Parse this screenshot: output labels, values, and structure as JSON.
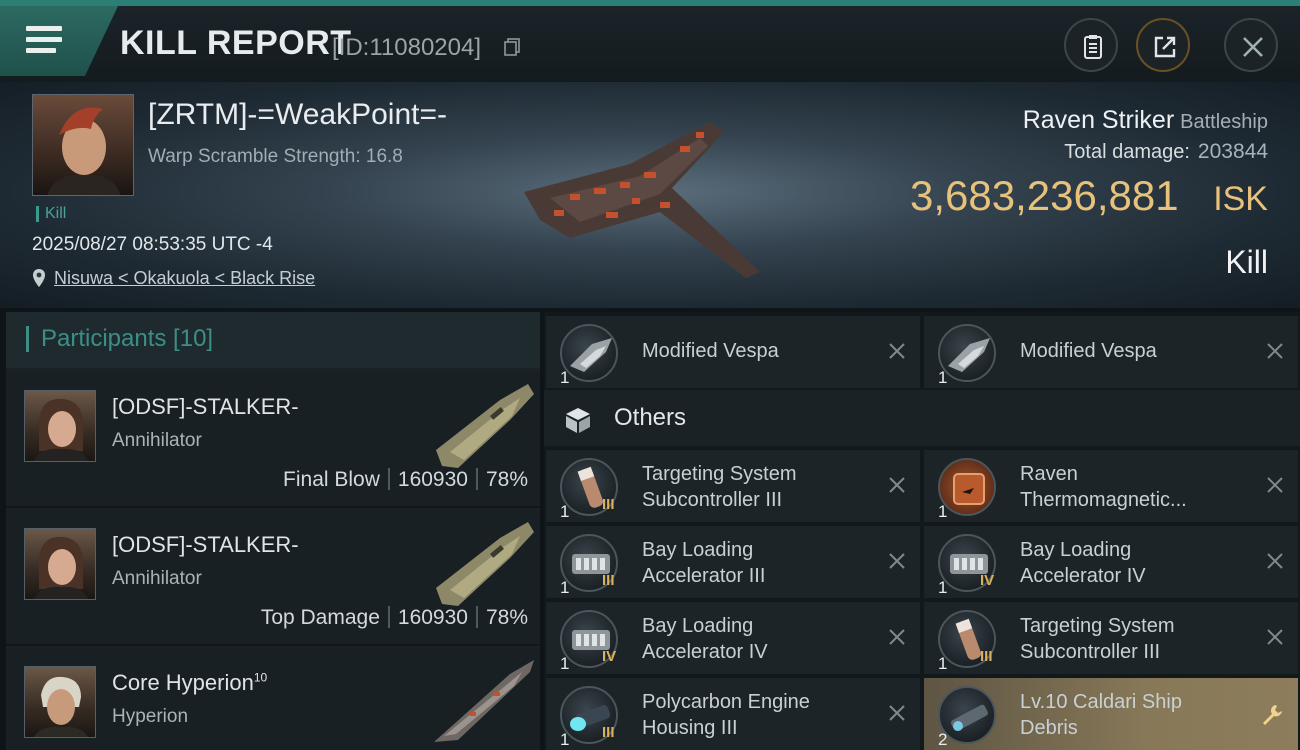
{
  "header": {
    "title": "KILL REPORT",
    "report_id": "[ID:11080204]"
  },
  "victim": {
    "name": "[ZRTM]-=WeakPoint=-",
    "warp_scramble": "Warp Scramble Strength: 16.8",
    "kill_tag": "Kill",
    "datetime": "2025/08/27 08:53:35 UTC -4",
    "location": "Nisuwa < Okakuola < Black Rise",
    "ship_name": "Raven Striker",
    "ship_class": "Battleship",
    "total_damage_label": "Total damage:",
    "total_damage_value": "203844",
    "isk_value": "3,683,236,881",
    "isk_unit": "ISK",
    "result": "Kill"
  },
  "participants": {
    "title": "Participants [10]",
    "rows": [
      {
        "name": "[ODSF]-STALKER-",
        "level": "",
        "ship": "Annihilator",
        "role": "Final Blow",
        "damage": "160930",
        "percent": "78%"
      },
      {
        "name": "[ODSF]-STALKER-",
        "level": "",
        "ship": "Annihilator",
        "role": "Top Damage",
        "damage": "160930",
        "percent": "78%"
      },
      {
        "name": "Core Hyperion",
        "level": "10",
        "ship": "Hyperion",
        "role": "",
        "damage": "",
        "percent": ""
      }
    ]
  },
  "drones": [
    {
      "name": "Modified Vespa",
      "qty": "1"
    },
    {
      "name": "Modified Vespa",
      "qty": "1"
    }
  ],
  "others": {
    "label": "Others",
    "items": [
      {
        "line1": "Targeting System",
        "line2": "Subcontroller III",
        "qty": "1",
        "tier": "III",
        "icon": "canister-icon"
      },
      {
        "line1": "Raven",
        "line2": "Thermomagnetic...",
        "qty": "1",
        "tier": "",
        "icon": "blueprint-icon"
      },
      {
        "line1": "Bay Loading",
        "line2": "Accelerator III",
        "qty": "1",
        "tier": "III",
        "icon": "launcher-icon"
      },
      {
        "line1": "Bay Loading",
        "line2": "Accelerator IV",
        "qty": "1",
        "tier": "IV",
        "icon": "launcher-icon"
      },
      {
        "line1": "Bay Loading",
        "line2": "Accelerator IV",
        "qty": "1",
        "tier": "IV",
        "icon": "launcher-icon"
      },
      {
        "line1": "Targeting System",
        "line2": "Subcontroller III",
        "qty": "1",
        "tier": "III",
        "icon": "canister-icon"
      },
      {
        "line1": "Polycarbon Engine",
        "line2": "Housing III",
        "qty": "1",
        "tier": "III",
        "icon": "engine-icon"
      },
      {
        "line1": "Lv.10 Caldari Ship",
        "line2": "Debris",
        "qty": "2",
        "tier": "",
        "icon": "debris-icon"
      }
    ]
  },
  "colors": {
    "accent_teal": "#3d8f86",
    "isk_gold": "#e8c27a",
    "tier_gold": "#d9b25e"
  }
}
